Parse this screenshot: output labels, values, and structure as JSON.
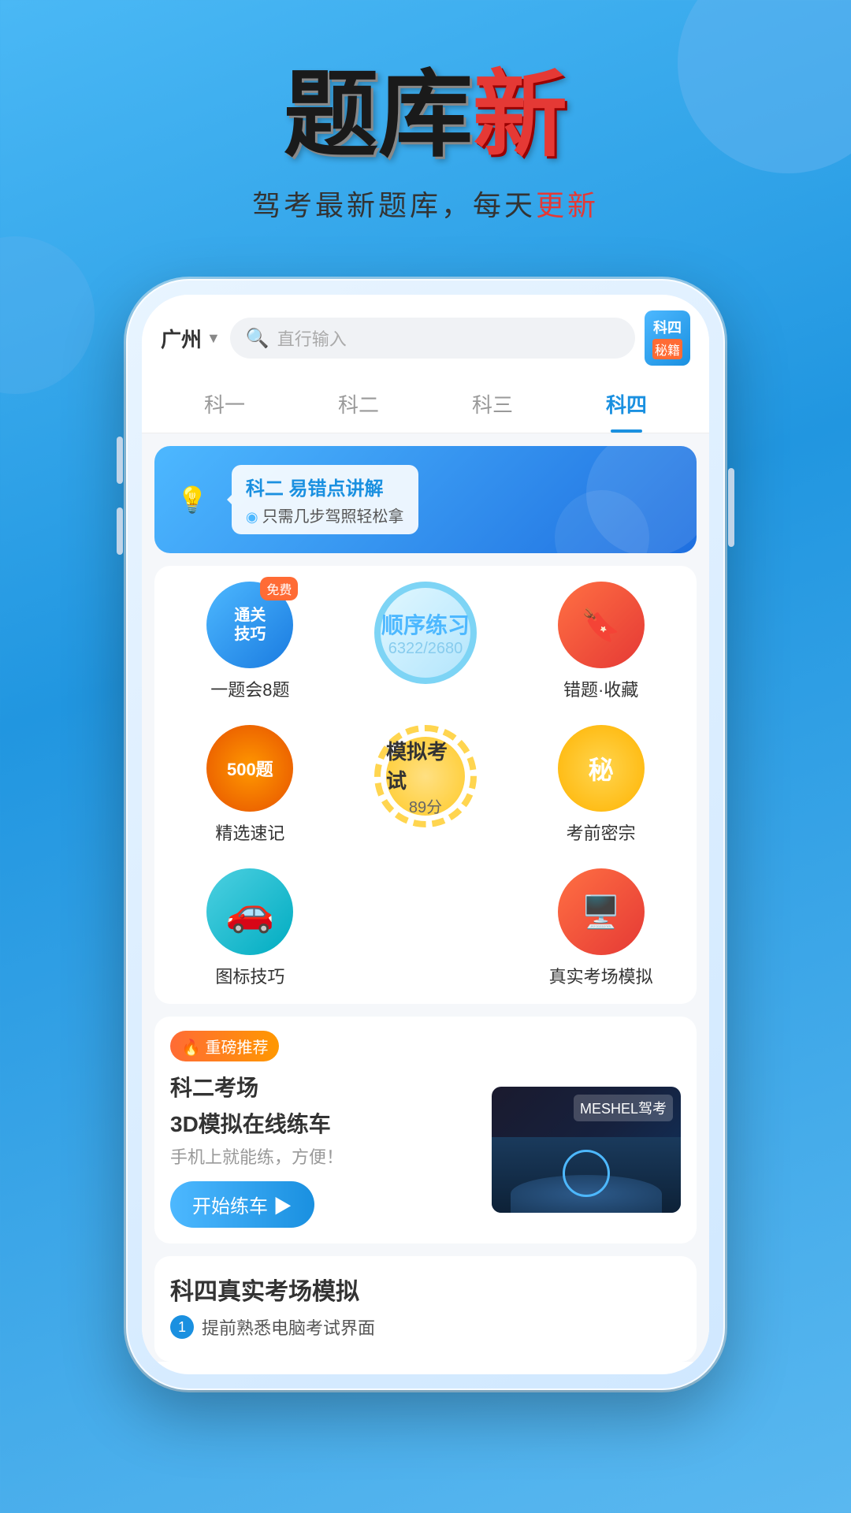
{
  "app": {
    "title_black": "题库",
    "title_red": "新",
    "subtitle_normal": "驾考最新题库，每天",
    "subtitle_red": "更新"
  },
  "topbar": {
    "location": "广州",
    "search_placeholder": "直行输入",
    "badge_line1": "科四",
    "badge_line2": "秘籍"
  },
  "nav_tabs": [
    {
      "label": "科一",
      "active": false
    },
    {
      "label": "科二",
      "active": false
    },
    {
      "label": "科三",
      "active": false
    },
    {
      "label": "科四",
      "active": true
    }
  ],
  "banner": {
    "title": "科二 易错点讲解",
    "subtitle": "只需几步驾照轻松拿"
  },
  "features": {
    "row1": {
      "item1": {
        "icon_text1": "通关",
        "icon_text2": "技巧",
        "free_badge": "免费",
        "label": "一题会8题"
      },
      "item2": {
        "main_text": "顺序练习",
        "sub_text": "6322/2680"
      },
      "item3": {
        "label": "错题·收藏"
      }
    },
    "row2": {
      "item1": {
        "icon_text": "500题",
        "label": "精选速记"
      },
      "item2": {
        "main_text": "模拟考试",
        "sub_text": "89分"
      },
      "item3": {
        "icon_text": "秘",
        "label": "考前密宗"
      }
    },
    "row3": {
      "item1": {
        "label": "图标技巧"
      },
      "item3": {
        "label": "真实考场模拟"
      }
    }
  },
  "recommendation": {
    "badge": "🔥 重磅推荐",
    "title": "科二考场",
    "title2": "3D模拟在线练车",
    "subtitle": "手机上就能练，方便！",
    "button": "开始练车 ▶",
    "image_label": "MESHEL驾考"
  },
  "bottom_section": {
    "title": "科四真实考场模拟",
    "item1": "提前熟悉电脑考试界面"
  }
}
